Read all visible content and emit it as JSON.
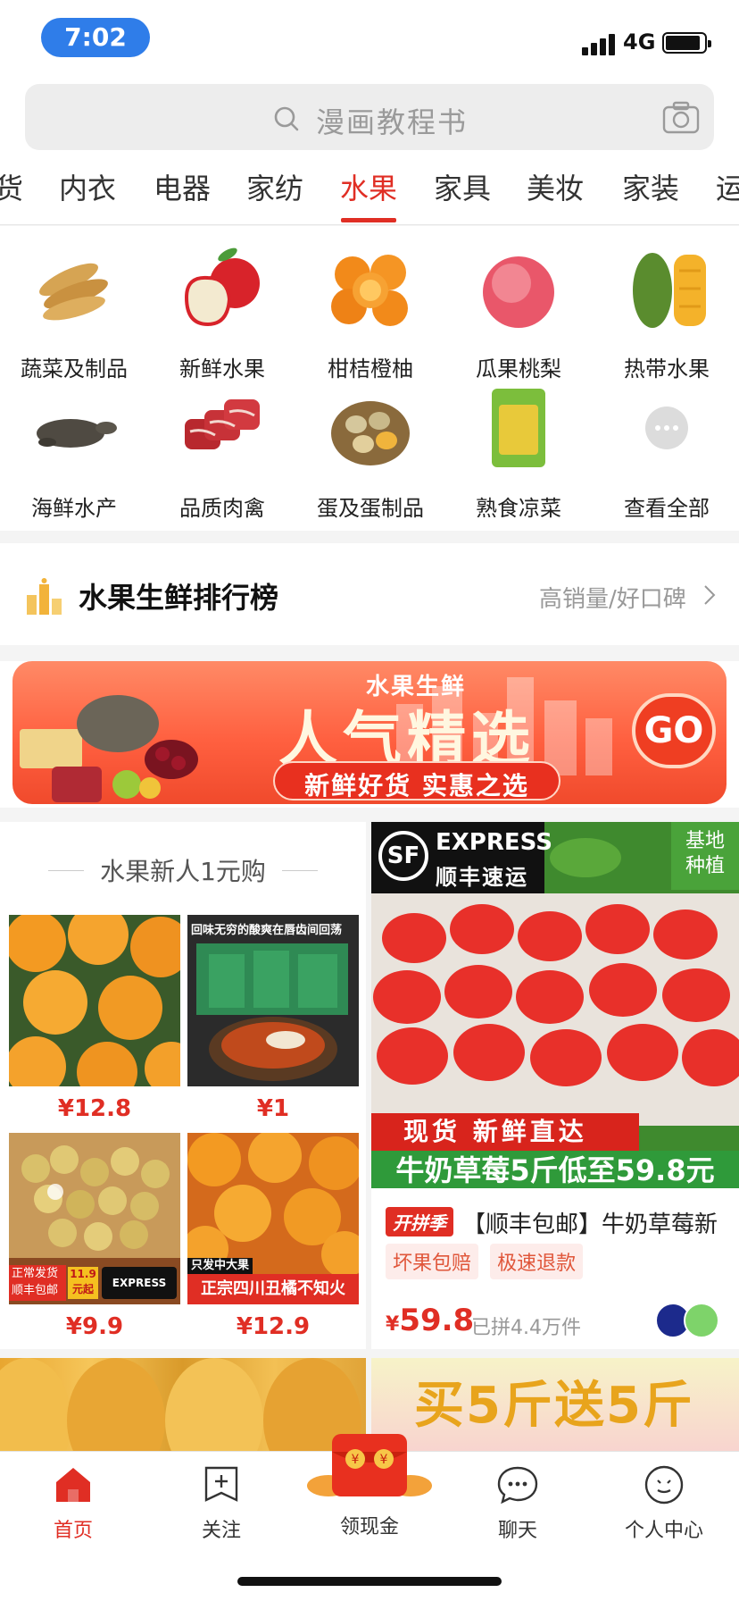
{
  "status_bar": {
    "time": "7:02",
    "network": "4G"
  },
  "search": {
    "placeholder": "漫画教程书"
  },
  "tabs": [
    {
      "label": "货"
    },
    {
      "label": "内衣"
    },
    {
      "label": "电器"
    },
    {
      "label": "家纺"
    },
    {
      "label": "水果",
      "active": true
    },
    {
      "label": "家具"
    },
    {
      "label": "美妆"
    },
    {
      "label": "家装"
    },
    {
      "label": "运"
    }
  ],
  "categories": [
    {
      "label": "蔬菜及制品",
      "icon": "sweet-potato-icon"
    },
    {
      "label": "新鲜水果",
      "icon": "apple-icon"
    },
    {
      "label": "柑桔橙柚",
      "icon": "orange-icon"
    },
    {
      "label": "瓜果桃梨",
      "icon": "peach-icon"
    },
    {
      "label": "热带水果",
      "icon": "mango-icon"
    },
    {
      "label": "海鲜水产",
      "icon": "turtle-icon"
    },
    {
      "label": "品质肉禽",
      "icon": "meat-icon"
    },
    {
      "label": "蛋及蛋制品",
      "icon": "egg-icon"
    },
    {
      "label": "熟食凉菜",
      "icon": "package-icon"
    },
    {
      "label": "查看全部",
      "icon": "more-icon"
    }
  ],
  "ranking": {
    "title": "水果生鲜排行榜",
    "subtitle": "高销量/好口碑"
  },
  "banner": {
    "small_title": "水果生鲜",
    "big_title": "人气精选",
    "subtitle": "新鲜好货 实惠之选",
    "go_label": "GO"
  },
  "new_user_section": {
    "title": "水果新人1元购",
    "products": [
      {
        "price": "¥12.8",
        "overlay": ""
      },
      {
        "price": "¥1",
        "overlay": "回味无穷的酸爽在唇齿间回荡"
      },
      {
        "price": "¥9.9",
        "overlay": "正常发货 顺丰包邮",
        "badge": "11.9元起"
      },
      {
        "price": "¥12.9",
        "overlay": "正宗四川丑橘不知火",
        "badge": "只发中大果"
      }
    ]
  },
  "featured": {
    "sf_circle": "SF",
    "sf_express": "EXPRESS",
    "sf_cn": "顺丰速运",
    "badge_line1": "基地",
    "badge_line2": "种植",
    "strip1": "现货  新鲜直达",
    "strip2": "牛奶草莓5斤低至59.8元",
    "promo_tag": "开拼季",
    "title": "【顺丰包邮】牛奶草莓新",
    "chips": [
      "坏果包赔",
      "极速退款"
    ],
    "price_symbol": "¥",
    "price": "59.8",
    "sold": "已拼4.4万件"
  },
  "peek": {
    "right_text": "买5斤送5斤"
  },
  "bottom_nav": [
    {
      "label": "首页",
      "icon": "home-icon",
      "active": true
    },
    {
      "label": "关注",
      "icon": "follow-icon"
    },
    {
      "label": "领现金",
      "icon": "red-packet-icon"
    },
    {
      "label": "聊天",
      "icon": "chat-icon"
    },
    {
      "label": "个人中心",
      "icon": "profile-icon"
    }
  ],
  "colors": {
    "accent": "#e02e24",
    "status_pill": "#2f7de9",
    "green_strip": "#2f9a3a"
  }
}
